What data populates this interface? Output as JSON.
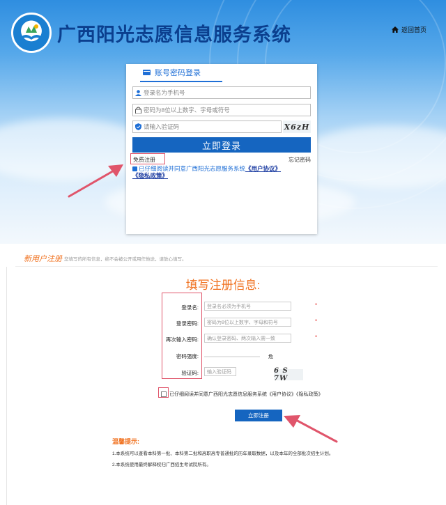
{
  "header": {
    "site_title": "广西阳光志愿信息服务系统",
    "home_link": "返回首页",
    "icons": {
      "home": "home-icon",
      "logo": "emblem-logo"
    }
  },
  "login": {
    "tab_label": "账号密码登录",
    "username_placeholder": "登录名为手机号",
    "password_placeholder": "密码为8位以上数字、字母或符号",
    "captcha_placeholder": "请输入验证码",
    "captcha_text": "X6zH",
    "login_button": "立即登录",
    "free_register": "免费注册",
    "forgot_password": "忘记密码",
    "agreement_prefix": "已仔细阅读并同意广西阳光志愿服务系统",
    "user_agreement": "《用户协议》",
    "privacy_policy": "《隐私政策》",
    "accent_color": "#1565c0"
  },
  "register": {
    "heading": "新用户注册",
    "subheading": "您填写的所有信息，绝不会被公开或用作他途，请放心填写。",
    "form_title": "填写注册信息:",
    "fields": [
      {
        "label": "登录名:",
        "placeholder": "登录名必须为手机号",
        "required": "*"
      },
      {
        "label": "登录密码:",
        "placeholder": "密码为8位以上数字、字母和符号",
        "required": "*"
      },
      {
        "label": "再次输入密码:",
        "placeholder": "确认登录密码、两次输入需一致",
        "required": "*"
      },
      {
        "label": "密码强度:",
        "strength_text": "危"
      },
      {
        "label": "验证码:",
        "placeholder": "输入验证码"
      }
    ],
    "captcha_text": "6 S 7W",
    "agreement": "已仔细阅读并同意广西阳光志愿信息服务系统《用户协议》《隐私政策》",
    "register_button": "立即注册",
    "tips_title": "温馨提示:",
    "tips": [
      "1.本系统可以查看本科第一批、本科第二批和高职高专普通批的历年录取数据，以及本年的全部批次招生计划。",
      "2.本系统使用最终解释权归广西招生考试院所有。"
    ],
    "highlight_color": "#f0711f",
    "annotation_color": "#e0556b"
  }
}
